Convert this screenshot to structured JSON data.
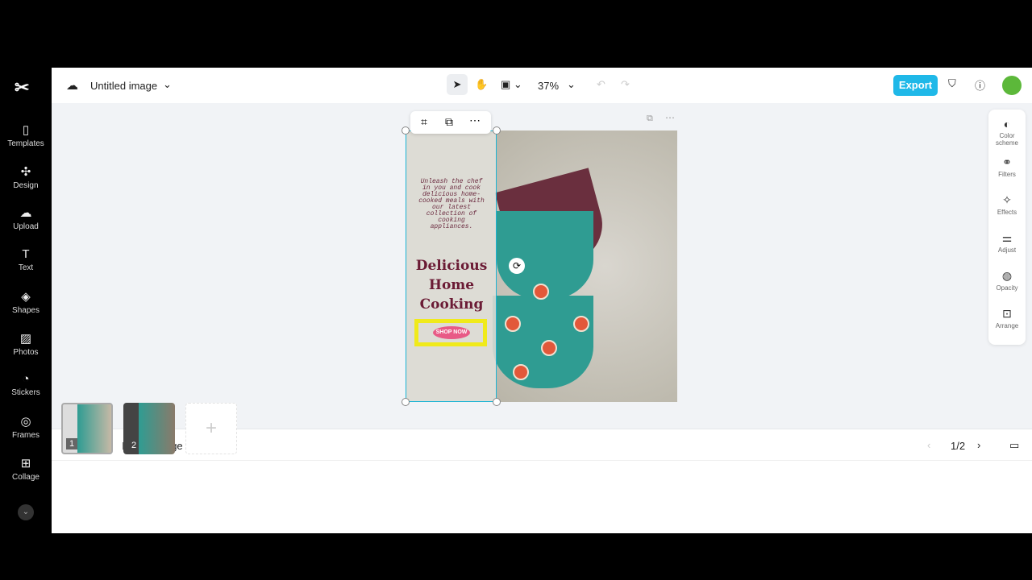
{
  "sidebar": {
    "items": [
      {
        "label": "Templates",
        "icon": "templates-icon"
      },
      {
        "label": "Design",
        "icon": "design-icon"
      },
      {
        "label": "Upload",
        "icon": "upload-icon"
      },
      {
        "label": "Text",
        "icon": "text-icon"
      },
      {
        "label": "Shapes",
        "icon": "shapes-icon"
      },
      {
        "label": "Photos",
        "icon": "photos-icon"
      },
      {
        "label": "Stickers",
        "icon": "stickers-icon"
      },
      {
        "label": "Frames",
        "icon": "frames-icon"
      },
      {
        "label": "Collage",
        "icon": "collage-icon"
      }
    ]
  },
  "header": {
    "title": "Untitled image",
    "zoom": "37%",
    "export_label": "Export"
  },
  "right_panel": {
    "items": [
      {
        "label": "Color scheme"
      },
      {
        "label": "Filters"
      },
      {
        "label": "Effects"
      },
      {
        "label": "Adjust"
      },
      {
        "label": "Opacity"
      },
      {
        "label": "Arrange"
      }
    ]
  },
  "design": {
    "body": "Unleash the chef in you and cook delicious home-cooked meals with our latest collection of cooking appliances.",
    "headline": "Delicious Home Cooking",
    "cta": "SHOP NOW"
  },
  "bottom": {
    "add_page": "Add page",
    "page_indicator": "1/2",
    "thumbs": [
      "1",
      "2"
    ]
  },
  "colors": {
    "accent": "#1fb8e8",
    "selection": "#19b4d4",
    "headline": "#6b1b35"
  }
}
